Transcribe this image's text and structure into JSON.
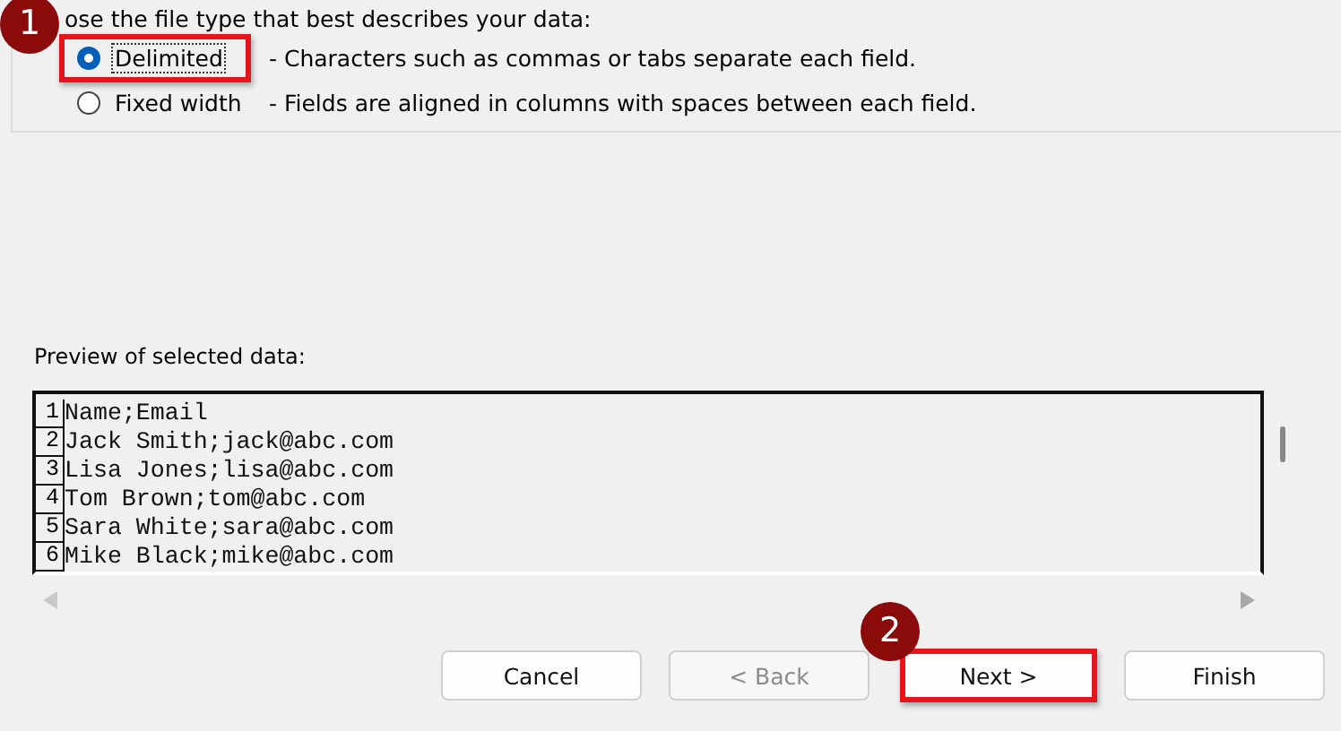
{
  "file_type": {
    "heading": "ose the file type that best describes your data:",
    "options": [
      {
        "label": "Delimited",
        "description": "- Characters such as commas or tabs separate each field.",
        "selected": true,
        "highlighted": true,
        "step_badge": "1"
      },
      {
        "label": "Fixed width",
        "description": "- Fields are aligned in columns with spaces between each field.",
        "selected": false,
        "highlighted": false
      }
    ]
  },
  "preview": {
    "label": "Preview of selected data:",
    "rows": [
      {
        "number": "1",
        "text": "Name;Email"
      },
      {
        "number": "2",
        "text": "Jack Smith;jack@abc.com"
      },
      {
        "number": "3",
        "text": "Lisa Jones;lisa@abc.com"
      },
      {
        "number": "4",
        "text": "Tom Brown;tom@abc.com"
      },
      {
        "number": "5",
        "text": "Sara White;sara@abc.com"
      },
      {
        "number": "6",
        "text": "Mike Black;mike@abc.com"
      }
    ]
  },
  "buttons": [
    {
      "label": "Cancel",
      "disabled": false,
      "highlighted": false
    },
    {
      "label": "< Back",
      "disabled": true,
      "highlighted": false
    },
    {
      "label": "Next >",
      "disabled": false,
      "highlighted": true,
      "step_badge": "2"
    },
    {
      "label": "Finish",
      "disabled": false,
      "highlighted": false
    }
  ]
}
